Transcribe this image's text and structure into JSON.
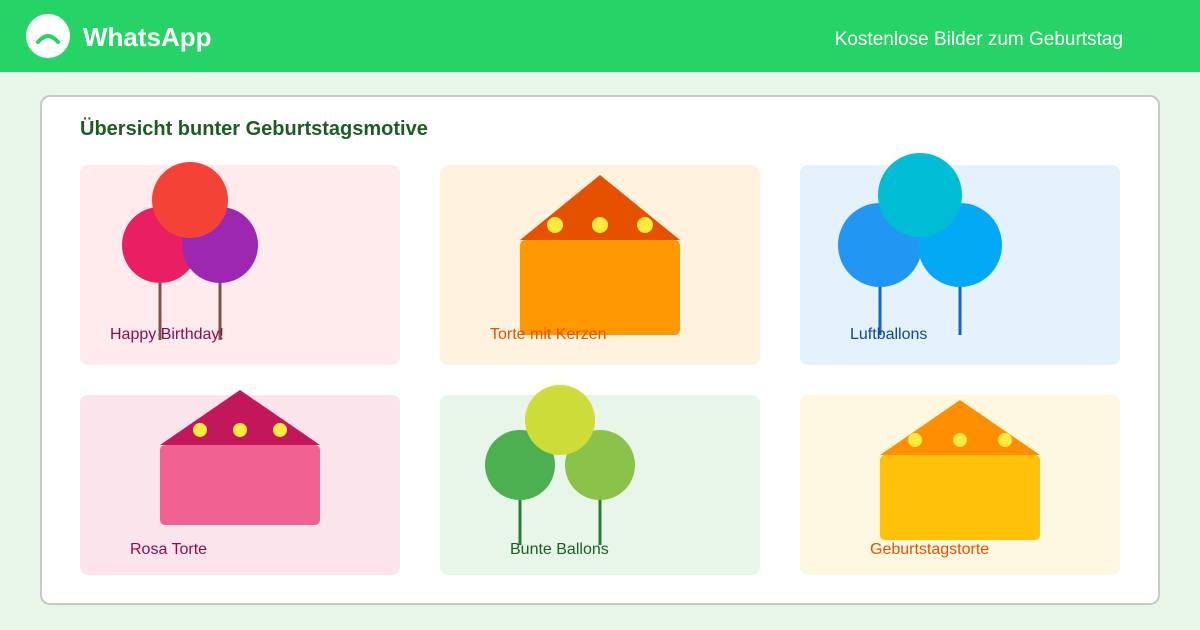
{
  "header": {
    "app_name": "WhatsApp",
    "caption": "Kostenlose Bilder zum Geburtstag",
    "logo_icon": "whatsapp-logo-icon",
    "bar_color": "#25d366"
  },
  "main": {
    "title": "Übersicht bunter Geburtstagsmotive",
    "cards": [
      {
        "label": "Happy Birthday!",
        "motif": "balloons-icon",
        "background": "#ffebee",
        "label_color": "#880e4f"
      },
      {
        "label": "Torte mit Kerzen",
        "motif": "cake-icon",
        "background": "#fff3e0",
        "label_color": "#e65100"
      },
      {
        "label": "Luftballons",
        "motif": "balloons-icon",
        "background": "#e3f2fd",
        "label_color": "#0d47a1"
      },
      {
        "label": "Rosa Torte",
        "motif": "cake-icon",
        "background": "#fce4ec",
        "label_color": "#880e4f"
      },
      {
        "label": "Bunte Ballons",
        "motif": "balloons-icon",
        "background": "#e8f5e9",
        "label_color": "#1b5e20"
      },
      {
        "label": "Geburtstagstorte",
        "motif": "cake-icon",
        "background": "#fff8e1",
        "label_color": "#e65100"
      }
    ]
  }
}
